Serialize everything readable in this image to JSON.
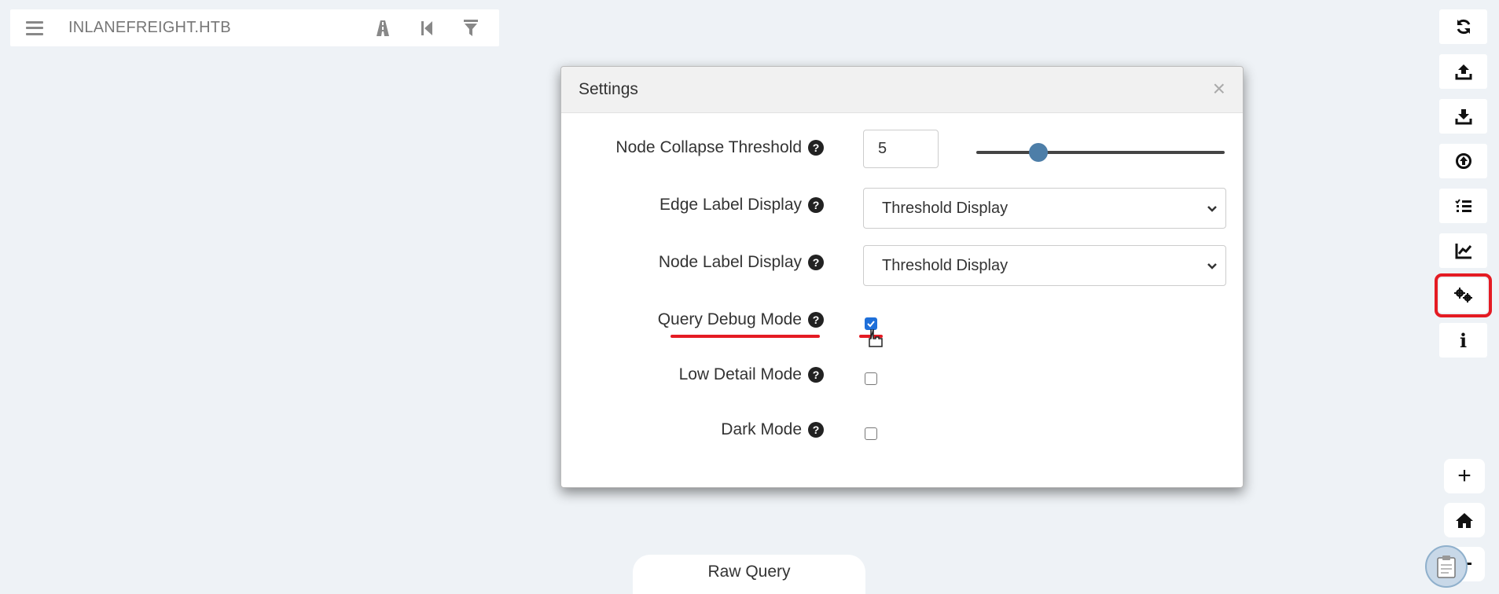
{
  "search_bar": {
    "domain": "INLANEFREIGHT.HTB",
    "icons": [
      "menu-icon",
      "road-icon",
      "step-backward-icon",
      "filter-icon"
    ]
  },
  "right_toolbar": {
    "buttons": [
      "refresh-icon",
      "upload-icon",
      "download-icon",
      "import-icon",
      "query-list-icon",
      "chart-icon",
      "settings-gears-icon",
      "info-icon"
    ],
    "info_label": "i",
    "active_button": "settings-gears-icon"
  },
  "zoom_toolbar": {
    "zoom_in_label": "+",
    "buttons": [
      "plus-icon",
      "home-icon",
      "minus-icon"
    ]
  },
  "settings_modal": {
    "title": "Settings",
    "close_label": "×",
    "node_collapse_threshold": {
      "label": "Node Collapse Threshold",
      "value": "5",
      "slider_fraction": 0.25
    },
    "edge_label_display": {
      "label": "Edge Label Display",
      "selected": "Threshold Display"
    },
    "node_label_display": {
      "label": "Node Label Display",
      "selected": "Threshold Display"
    },
    "query_debug_mode": {
      "label": "Query Debug Mode",
      "checked": true
    },
    "low_detail_mode": {
      "label": "Low Detail Mode",
      "checked": false
    },
    "dark_mode": {
      "label": "Dark Mode",
      "checked": false
    },
    "help_glyph": "?"
  },
  "raw_query": {
    "label": "Raw Query"
  },
  "colors": {
    "annotation_red": "#e41b23",
    "checkbox_blue": "#1e6fd9",
    "slider_thumb": "#4d7ea8",
    "background": "#eef2f6"
  }
}
